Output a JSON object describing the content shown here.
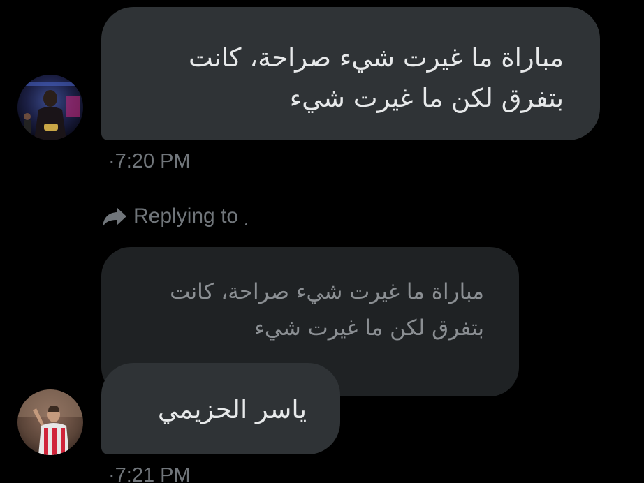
{
  "messages": [
    {
      "lines": [
        "مباراة ما غيرت شيء صراحة، كانت",
        "بتفرق لكن ما غيرت شيء"
      ],
      "timestamp": "·7:20 PM"
    },
    {
      "reply_label": "Replying to",
      "quoted_lines": [
        "مباراة ما غيرت شيء صراحة، كانت",
        "بتفرق لكن ما غيرت شيء"
      ],
      "lines": [
        "ياسر الحزيمي"
      ],
      "timestamp": "·7:21 PM"
    }
  ],
  "icons": {
    "reply": "reply-arrow-icon"
  },
  "colors": {
    "background": "#000000",
    "bubble": "#2f3336",
    "quoted_bubble": "#1f2224",
    "text": "#e7e9ea",
    "muted_text": "#71767b"
  }
}
